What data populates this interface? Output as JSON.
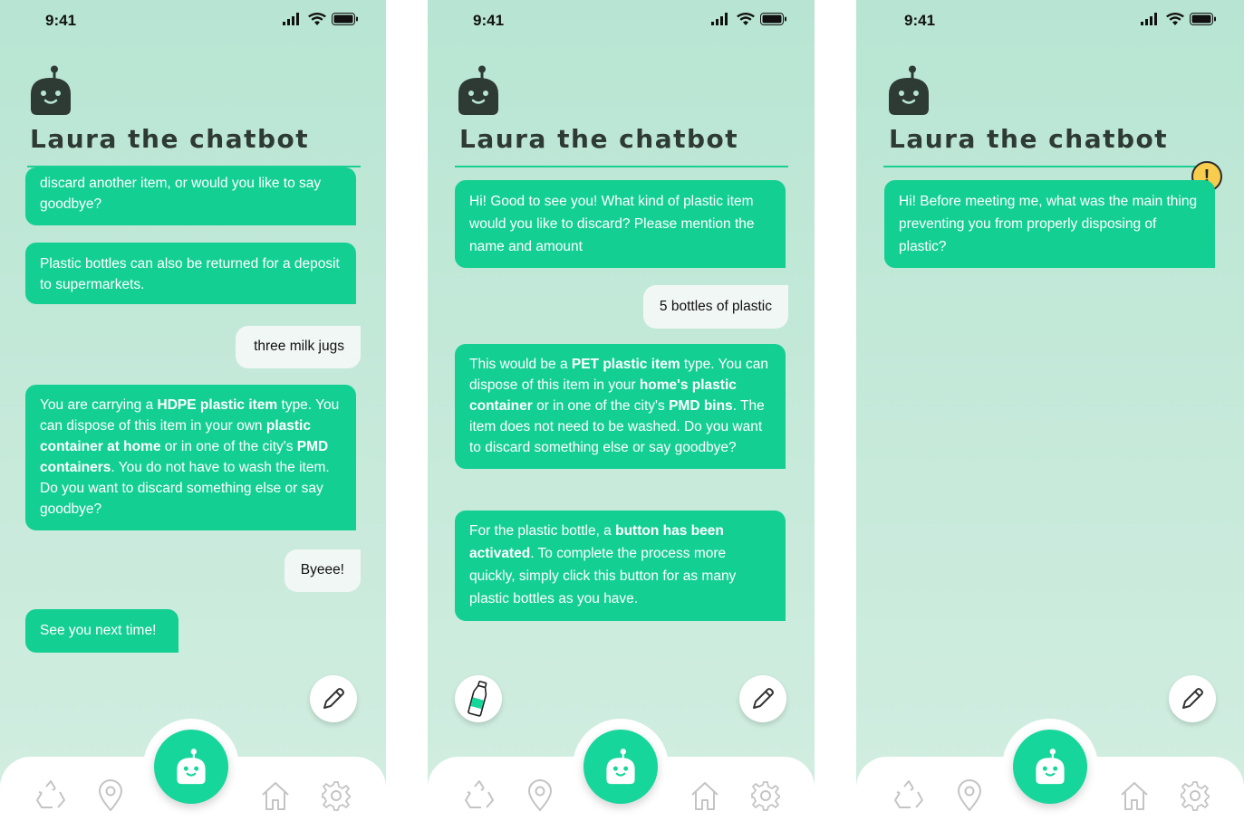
{
  "status": {
    "time": "9:41"
  },
  "header": {
    "title": "Laura the chatbot"
  },
  "screens": [
    {
      "messages": [
        {
          "text": "discard another item, or would you like to say goodbye?"
        },
        {
          "text": "Plastic bottles can also be returned for a deposit to supermarkets."
        },
        {
          "text": "three milk jugs"
        },
        {
          "parts": [
            "You are carrying a ",
            "HDPE plastic item",
            " type. You can dispose of this item in your own ",
            "plastic container at home",
            " or in one of the city's ",
            "PMD containers",
            ". You do not have to wash the item. Do you want to discard something else or say goodbye?"
          ]
        },
        {
          "text": "Byeee!"
        },
        {
          "text": "See you next time!"
        }
      ]
    },
    {
      "messages": [
        {
          "text": "Hi! Good to see you! What kind of plastic item would you like to discard? Please mention the name and amount"
        },
        {
          "text": "5 bottles of plastic"
        },
        {
          "parts": [
            "This would be a ",
            "PET plastic item",
            " type. You can dispose of this item in your ",
            "home's plastic container",
            " or in one of the city's ",
            "PMD bins",
            ". The item does not need to be washed. Do you want to discard something else or say goodbye?"
          ]
        },
        {
          "parts": [
            "For the plastic bottle, a ",
            "button has been activated",
            ". To complete the process more quickly, simply click this button for as many plastic bottles as you have."
          ]
        }
      ]
    },
    {
      "messages": [
        {
          "text": "Hi! Before meeting me, what was the main thing preventing you from properly disposing of plastic?"
        }
      ],
      "warning_badge": "!"
    }
  ]
}
